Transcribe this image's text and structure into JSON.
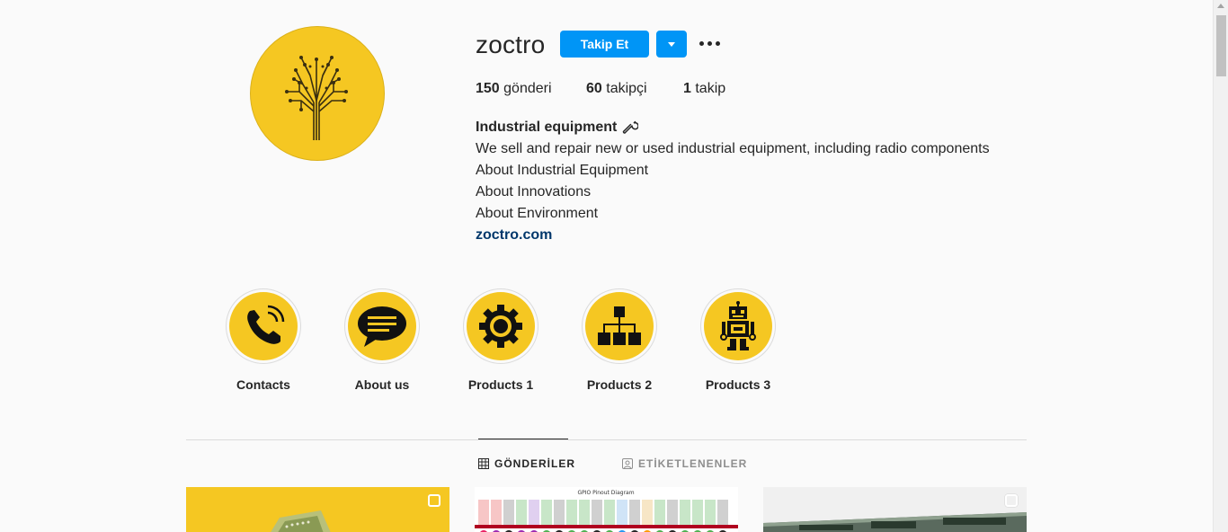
{
  "profile": {
    "username": "zoctro",
    "follow_label": "Takip Et",
    "stats": {
      "posts_count": "150",
      "posts_label": "gönderi",
      "followers_count": "60",
      "followers_label": "takipçi",
      "following_count": "1",
      "following_label": "takip"
    },
    "bio": {
      "name": "Industrial equipment",
      "lines": [
        "We sell and repair new or used industrial equipment, including radio components",
        "About Industrial Equipment",
        "About Innovations",
        "About Environment"
      ],
      "link": "zoctro.com"
    }
  },
  "highlights": [
    {
      "label": "Contacts",
      "icon": "phone-icon"
    },
    {
      "label": "About us",
      "icon": "chat-bubble-icon"
    },
    {
      "label": "Products 1",
      "icon": "gear-icon"
    },
    {
      "label": "Products 2",
      "icon": "hierarchy-icon"
    },
    {
      "label": "Products 3",
      "icon": "robot-icon"
    }
  ],
  "tabs": {
    "posts": "GÖNDERİLER",
    "tagged": "ETİKETLENENLER"
  },
  "posts": [
    {
      "caption": ""
    },
    {
      "caption": "GPIO Pinout Diagram"
    },
    {
      "caption": ""
    }
  ],
  "colors": {
    "accent": "#0095f6",
    "brand_yellow": "#f5c722",
    "link": "#00376b"
  }
}
